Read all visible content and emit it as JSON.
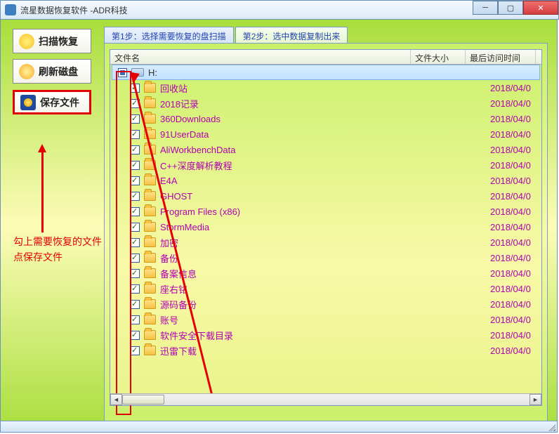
{
  "window": {
    "title": "流星数据恢复软件   -ADR科技"
  },
  "sidebar": {
    "scan_label": "扫描恢复",
    "refresh_label": "刷新磁盘",
    "save_label": "保存文件"
  },
  "annotation": {
    "line1": "勾上需要恢复的文件",
    "line2": "点保存文件"
  },
  "tabs": {
    "tab1": "第1步：选择需要恢复的盘扫描",
    "tab2": "第2步：选中数据复制出来"
  },
  "columns": {
    "name": "文件名",
    "size": "文件大小",
    "date": "最后访问时间"
  },
  "root": {
    "label": "H:"
  },
  "files": [
    {
      "name": "回收站",
      "date": "2018/04/0"
    },
    {
      "name": "2018记录",
      "date": "2018/04/0"
    },
    {
      "name": "360Downloads",
      "date": "2018/04/0"
    },
    {
      "name": "91UserData",
      "date": "2018/04/0"
    },
    {
      "name": "AliWorkbenchData",
      "date": "2018/04/0"
    },
    {
      "name": "C++深度解析教程",
      "date": "2018/04/0"
    },
    {
      "name": "E4A",
      "date": "2018/04/0"
    },
    {
      "name": "GHOST",
      "date": "2018/04/0"
    },
    {
      "name": "Program Files (x86)",
      "date": "2018/04/0"
    },
    {
      "name": "StormMedia",
      "date": "2018/04/0"
    },
    {
      "name": "加密",
      "date": "2018/04/0"
    },
    {
      "name": "备份",
      "date": "2018/04/0"
    },
    {
      "name": "备案信息",
      "date": "2018/04/0"
    },
    {
      "name": "座右铭",
      "date": "2018/04/0"
    },
    {
      "name": "源码备份",
      "date": "2018/04/0"
    },
    {
      "name": "账号",
      "date": "2018/04/0"
    },
    {
      "name": "软件安全下载目录",
      "date": "2018/04/0"
    },
    {
      "name": "迅雷下载",
      "date": "2018/04/0"
    }
  ]
}
